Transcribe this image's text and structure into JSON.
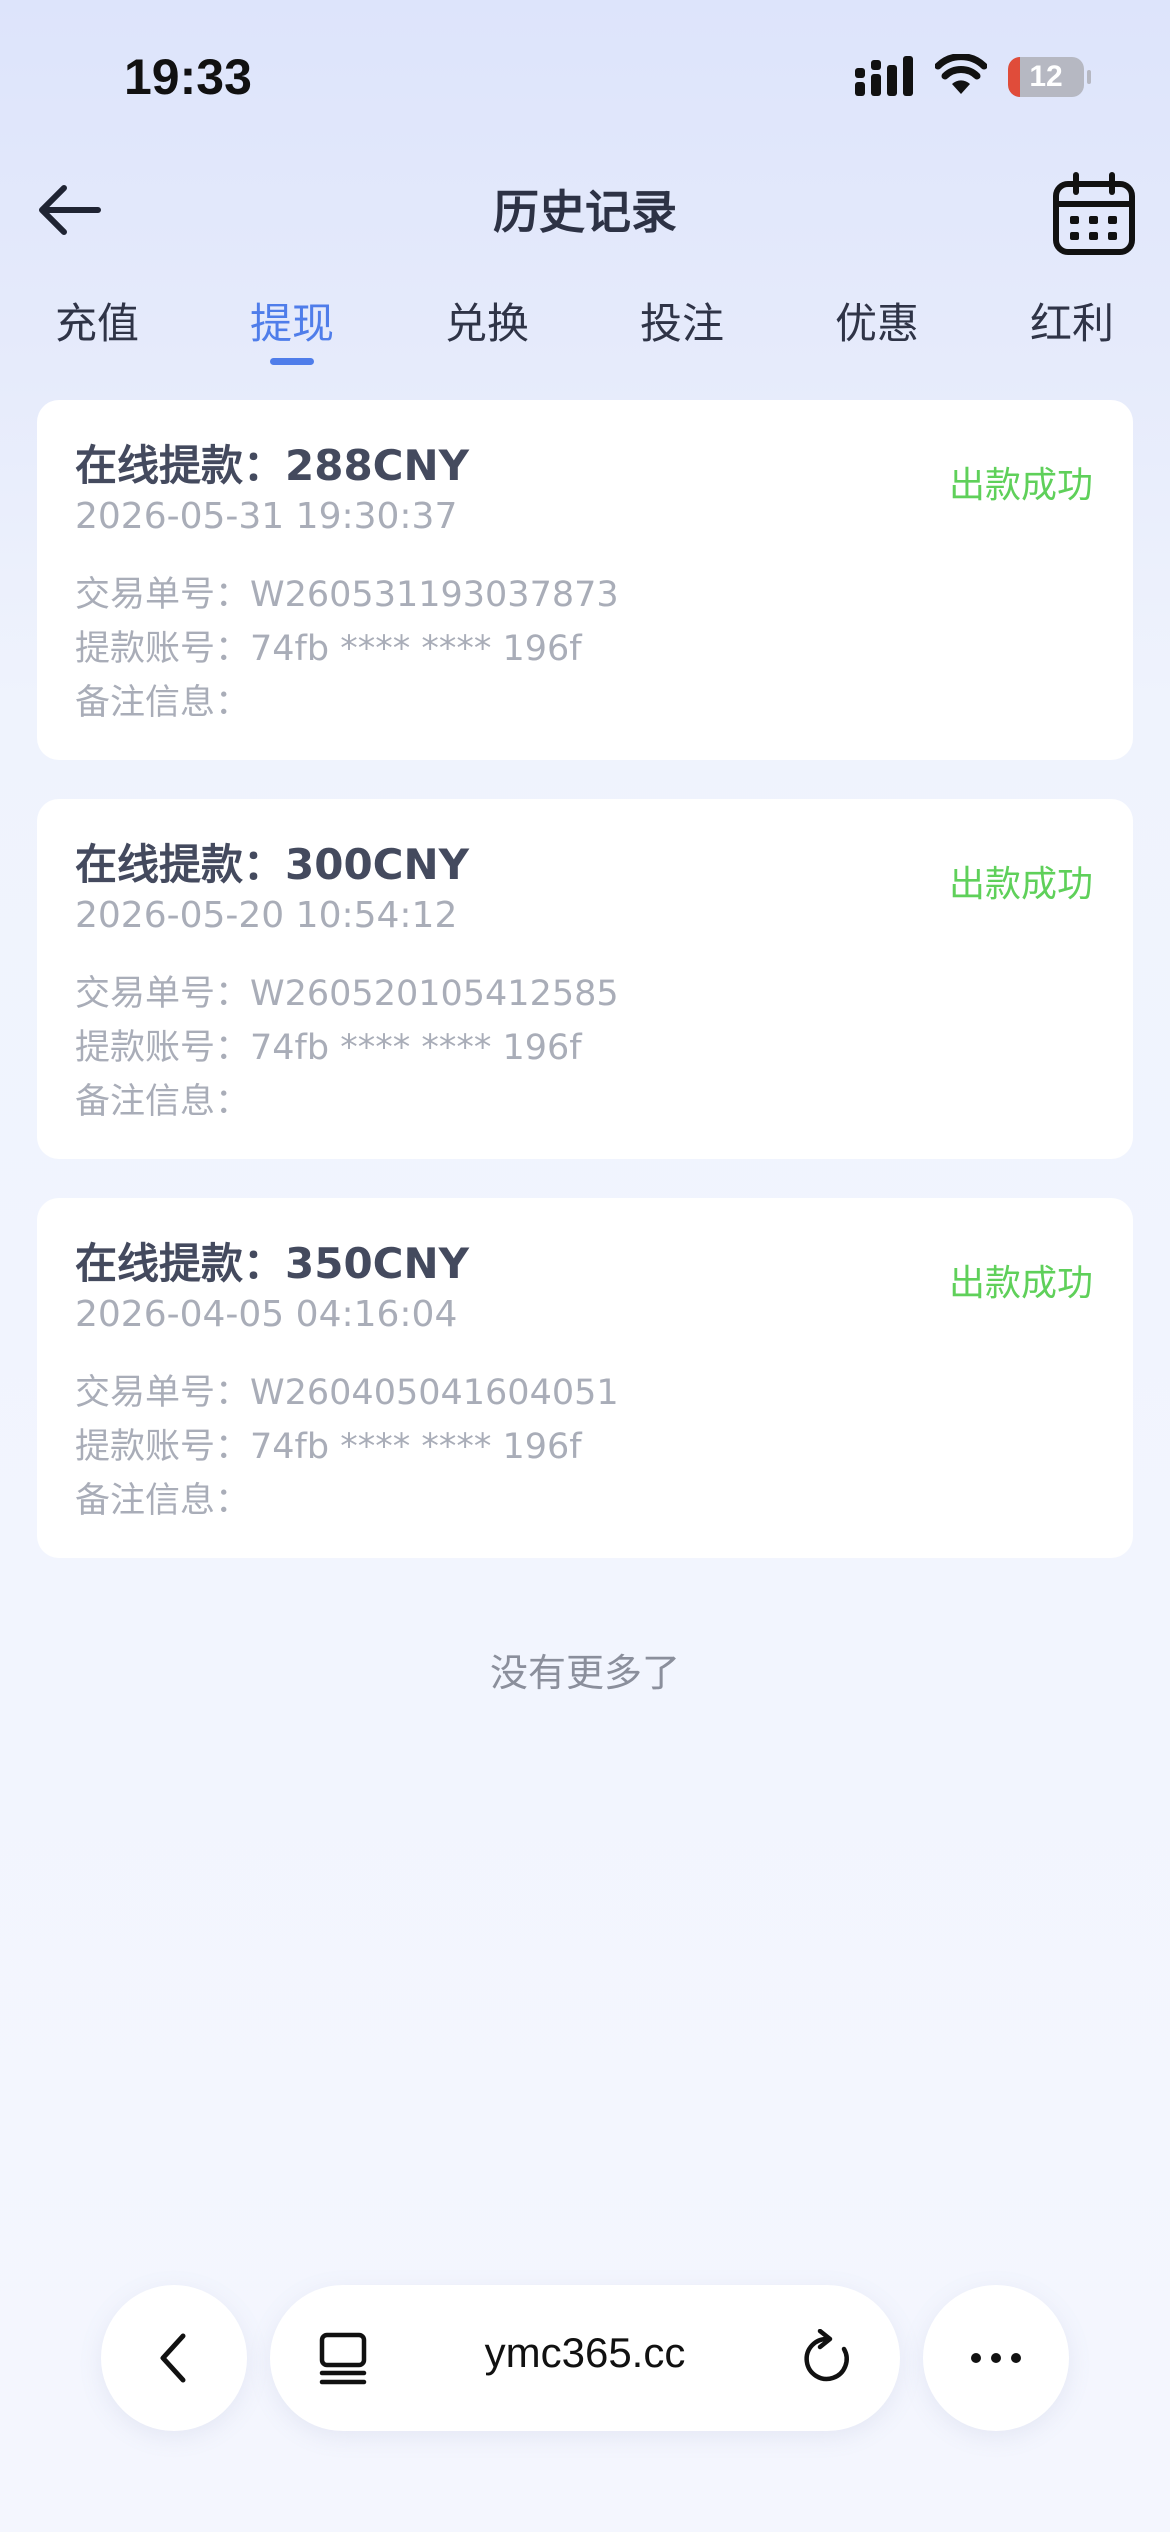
{
  "status_bar": {
    "time": "19:33",
    "battery": "12"
  },
  "header": {
    "title": "历史记录"
  },
  "tabs": [
    {
      "label": "充值"
    },
    {
      "label": "提现"
    },
    {
      "label": "兑换"
    },
    {
      "label": "投注"
    },
    {
      "label": "优惠"
    },
    {
      "label": "红利"
    }
  ],
  "active_tab": "提现",
  "records": [
    {
      "title": "在线提款：288CNY",
      "status": "出款成功",
      "datetime": "2026-05-31 19:30:37",
      "order_label": "交易单号：",
      "order_no": "W260531193037873",
      "account_label": "提款账号：",
      "account": "74fb **** **** 196f",
      "note_label": "备注信息："
    },
    {
      "title": "在线提款：300CNY",
      "status": "出款成功",
      "datetime": "2026-05-20 10:54:12",
      "order_label": "交易单号：",
      "order_no": "W260520105412585",
      "account_label": "提款账号：",
      "account": "74fb **** **** 196f",
      "note_label": "备注信息："
    },
    {
      "title": "在线提款：350CNY",
      "status": "出款成功",
      "datetime": "2026-04-05 04:16:04",
      "order_label": "交易单号：",
      "order_no": "W260405041604051",
      "account_label": "提款账号：",
      "account": "74fb **** **** 196f",
      "note_label": "备注信息："
    }
  ],
  "footer_text": "没有更多了",
  "browser": {
    "url": "ymc365.cc"
  },
  "colors": {
    "accent": "#4f7dea",
    "success": "#5fd05a",
    "battery_low": "#e04c3a"
  },
  "icons": [
    "back-arrow-icon",
    "calendar-icon",
    "signal-icon",
    "wifi-icon",
    "battery-icon",
    "browser-back-icon",
    "tabs-icon",
    "reload-icon",
    "more-icon"
  ]
}
